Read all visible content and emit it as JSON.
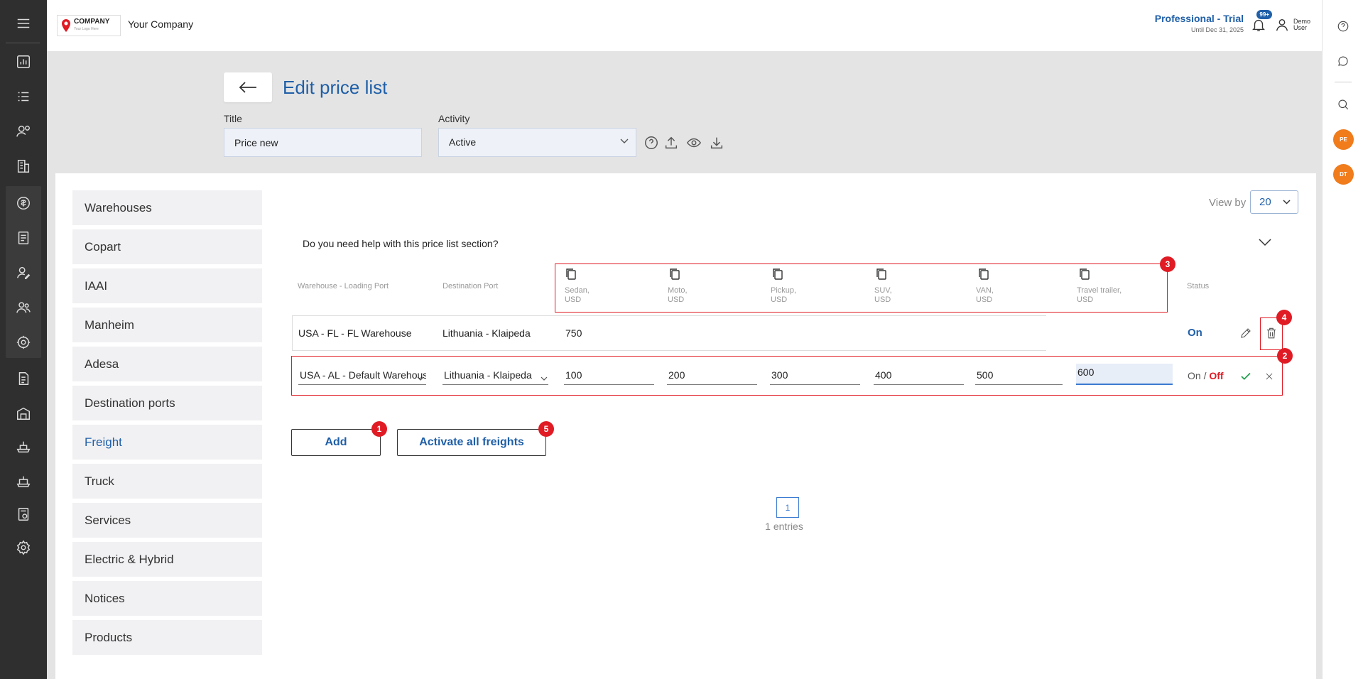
{
  "header": {
    "logo_text": "COMPANY",
    "logo_sub": "Your Logo Here",
    "company_name": "Your Company",
    "plan_title": "Professional - Trial",
    "plan_until": "Until Dec 31, 2025",
    "notifications_badge": "99+",
    "user_first": "Demo",
    "user_last": "User"
  },
  "page": {
    "back_label": "←",
    "title": "Edit price list",
    "title_field_label": "Title",
    "title_value": "Price new",
    "activity_label": "Activity",
    "activity_value": "Active"
  },
  "categories": [
    {
      "label": "Warehouses",
      "active": false
    },
    {
      "label": "Copart",
      "active": false
    },
    {
      "label": "IAAI",
      "active": false
    },
    {
      "label": "Manheim",
      "active": false
    },
    {
      "label": "Adesa",
      "active": false
    },
    {
      "label": "Destination ports",
      "active": false
    },
    {
      "label": "Freight",
      "active": true
    },
    {
      "label": "Truck",
      "active": false
    },
    {
      "label": "Services",
      "active": false
    },
    {
      "label": "Electric & Hybrid",
      "active": false
    },
    {
      "label": "Notices",
      "active": false
    },
    {
      "label": "Products",
      "active": false
    }
  ],
  "table": {
    "view_by_label": "View by",
    "view_by_value": "20",
    "help_question": "Do you need help with this price list section?",
    "col_warehouse": "Warehouse - Loading Port",
    "col_destination": "Destination Port",
    "vehicle_cols": [
      {
        "name": "Sedan,",
        "unit": "USD"
      },
      {
        "name": "Moto,",
        "unit": "USD"
      },
      {
        "name": "Pickup,",
        "unit": "USD"
      },
      {
        "name": "SUV,",
        "unit": "USD"
      },
      {
        "name": "VAN,",
        "unit": "USD"
      },
      {
        "name": "Travel trailer,",
        "unit": "USD"
      }
    ],
    "col_status": "Status",
    "rows": [
      {
        "warehouse": "USA - FL - FL Warehouse",
        "destination": "Lithuania - Klaipeda",
        "sedan": "750",
        "status": "On"
      }
    ],
    "edit_row": {
      "warehouse": "USA - AL - Default Warehouse",
      "destination": "Lithuania - Klaipeda",
      "prices": [
        "100",
        "200",
        "300",
        "400",
        "500",
        "600"
      ],
      "status_on": "On",
      "status_sep": "/",
      "status_off": "Off"
    },
    "add_label": "Add",
    "activate_label": "Activate all freights",
    "current_page": "1",
    "entries_text": "1 entries"
  },
  "markers": [
    "1",
    "2",
    "3",
    "4",
    "5"
  ],
  "right_rail": {
    "avatar1": "PE",
    "avatar2": "DT"
  },
  "colors": {
    "accent": "#1f5fa8",
    "highlight": "#e01b24",
    "sidebar": "#2f2f2f",
    "avatar": "#f07c1c"
  }
}
